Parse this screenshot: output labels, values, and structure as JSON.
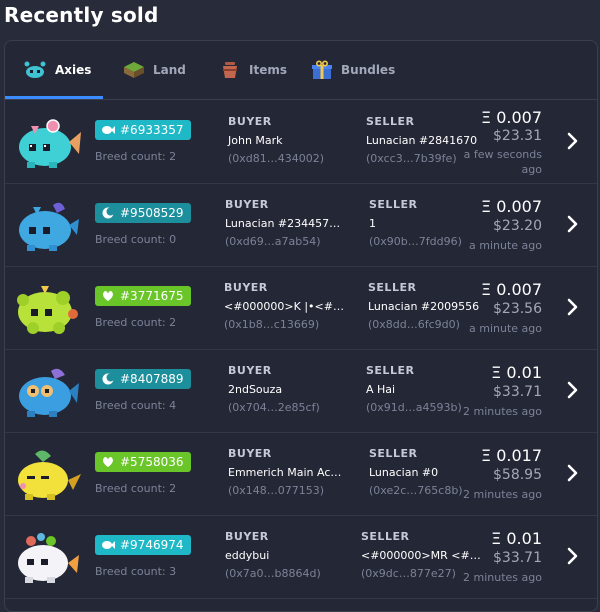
{
  "page_title": "Recently sold",
  "tabs": [
    {
      "label": "Axies",
      "icon": "axie-icon",
      "active": true
    },
    {
      "label": "Land",
      "icon": "land-icon",
      "active": false
    },
    {
      "label": "Items",
      "icon": "items-pot-icon",
      "active": false
    },
    {
      "label": "Bundles",
      "icon": "bundle-gift-icon",
      "active": false
    }
  ],
  "columns": {
    "buyer": "BUYER",
    "seller": "SELLER"
  },
  "colors": {
    "aquatic": "#1fb8c7",
    "bird": "#1fb8c7",
    "moon": "#1d8f9c",
    "plant": "#6ac528"
  },
  "sales": [
    {
      "id": "#6933357",
      "class_icon": "aquatic-fish-icon",
      "badge_color": "#1fb8c7",
      "breed": "Breed count: 2",
      "buyer_name": "John Mark",
      "buyer_addr": "(0xd81…434002)",
      "seller_name": "Lunacian #2841670",
      "seller_addr": "(0xcc3…7b39fe)",
      "eth": "Ξ 0.007",
      "usd": "$23.31",
      "time": "a few seconds ago"
    },
    {
      "id": "#9508529",
      "class_icon": "moon-icon",
      "badge_color": "#1d8f9c",
      "breed": "Breed count: 0",
      "buyer_name": "Lunacian #234457…",
      "buyer_addr": "(0xd69…a7ab54)",
      "seller_name": "1",
      "seller_addr": "(0x90b…7fdd96)",
      "eth": "Ξ 0.007",
      "usd": "$23.20",
      "time": "a minute ago"
    },
    {
      "id": "#3771675",
      "class_icon": "plant-leaf-icon",
      "badge_color": "#6ac528",
      "breed": "Breed count: 2",
      "buyer_name": "<#000000>K |•<#…",
      "buyer_addr": "(0x1b8…c13669)",
      "seller_name": "Lunacian #2009556",
      "seller_addr": "(0x8dd…6fc9d0)",
      "eth": "Ξ 0.007",
      "usd": "$23.56",
      "time": "a minute ago"
    },
    {
      "id": "#8407889",
      "class_icon": "moon-icon",
      "badge_color": "#1d8f9c",
      "breed": "Breed count: 4",
      "buyer_name": "2ndSouza",
      "buyer_addr": "(0x704…2e85cf)",
      "seller_name": "A Hai",
      "seller_addr": "(0x91d…a4593b)",
      "eth": "Ξ 0.01",
      "usd": "$33.71",
      "time": "2 minutes ago"
    },
    {
      "id": "#5758036",
      "class_icon": "plant-leaf-icon",
      "badge_color": "#6ac528",
      "breed": "Breed count: 2",
      "buyer_name": "Emmerich Main Ac…",
      "buyer_addr": "(0x148…077153)",
      "seller_name": "Lunacian #0",
      "seller_addr": "(0xe2c…765c8b)",
      "eth": "Ξ 0.017",
      "usd": "$58.95",
      "time": "2 minutes ago"
    },
    {
      "id": "#9746974",
      "class_icon": "aquatic-fish-icon",
      "badge_color": "#1fb8c7",
      "breed": "Breed count: 3",
      "buyer_name": "eddybui",
      "buyer_addr": "(0x7a0…b8864d)",
      "seller_name": "<#000000>MR <#…",
      "seller_addr": "(0x9dc…877e27)",
      "eth": "Ξ 0.01",
      "usd": "$33.71",
      "time": "2 minutes ago"
    }
  ]
}
